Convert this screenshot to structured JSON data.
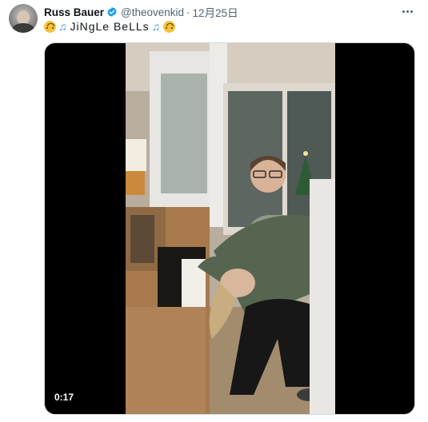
{
  "tweet": {
    "author_name": "Russ Bauer",
    "handle": "@theovenkid",
    "separator": "·",
    "date": "12月25日",
    "verified": true,
    "text": "JiNgLe BeLLs",
    "text_emojis": [
      "upside-down-face",
      "musical-notes",
      "musical-notes",
      "upside-down-face"
    ]
  },
  "media": {
    "type": "video",
    "timestamp": "0:17"
  },
  "colors": {
    "secondary_text": "#536471",
    "verified_badge": "#1d9bf0",
    "media_background": "#000000"
  }
}
